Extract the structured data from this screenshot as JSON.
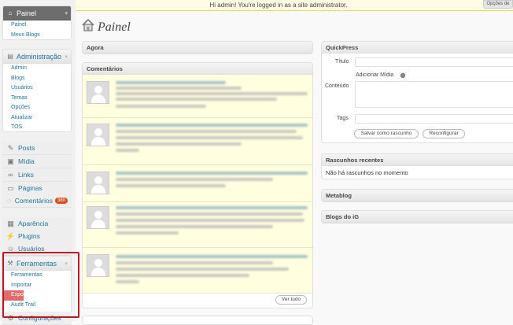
{
  "notice": {
    "text": "Hi admin! You're logged in as a site administrator.",
    "screen_options": "Opções de"
  },
  "page": {
    "title": "Painel"
  },
  "sidebar": {
    "dashboard": {
      "label": "Painel",
      "items": [
        "Painel",
        "Meus Blogs"
      ]
    },
    "admin": {
      "label": "Administração",
      "items": [
        "Admin",
        "Blogs",
        "Usuários",
        "Temas",
        "Opções",
        "Atualizar",
        "TOS"
      ]
    },
    "main_items": [
      {
        "label": "Posts",
        "icon": "pin-icon"
      },
      {
        "label": "Mídia",
        "icon": "media-icon"
      },
      {
        "label": "Links",
        "icon": "link-icon"
      },
      {
        "label": "Páginas",
        "icon": "page-icon"
      },
      {
        "label": "Comentários",
        "icon": "comment-icon",
        "badge": "380"
      }
    ],
    "appearance_items": [
      {
        "label": "Aparência",
        "icon": "appearance-icon"
      },
      {
        "label": "Plugins",
        "icon": "plugin-icon"
      },
      {
        "label": "Usuários",
        "icon": "users-icon"
      }
    ],
    "tools": {
      "label": "Ferramentas",
      "items": [
        "Ferramentas",
        "Importar",
        "Exportar",
        "Audit Trail"
      ],
      "highlighted": "Exportar"
    },
    "settings": {
      "label": "Configurações"
    }
  },
  "boxes": {
    "agora": {
      "title": "Agora"
    },
    "comentarios": {
      "title": "Comentários",
      "button": "Ver tudo"
    },
    "quickpress": {
      "title": "QuickPress",
      "titulo_label": "Título",
      "media_label": "Adicionar Mídia",
      "conteudo_label": "Conteúdo",
      "tags_label": "Tags",
      "save_draft": "Salvar como rascunho",
      "reset": "Reconfigurar"
    },
    "rascunhos": {
      "title": "Rascunhos recentes",
      "text": "Não há rascunhos no momento"
    },
    "metablog": {
      "title": "Metablog"
    },
    "blogs_ig": {
      "title": "Blogs do iG"
    }
  },
  "colors": {
    "link": "#21759b",
    "highlight_border": "#c0141e",
    "badge": "#d54e21",
    "comment_bg": "#ffffe0"
  }
}
